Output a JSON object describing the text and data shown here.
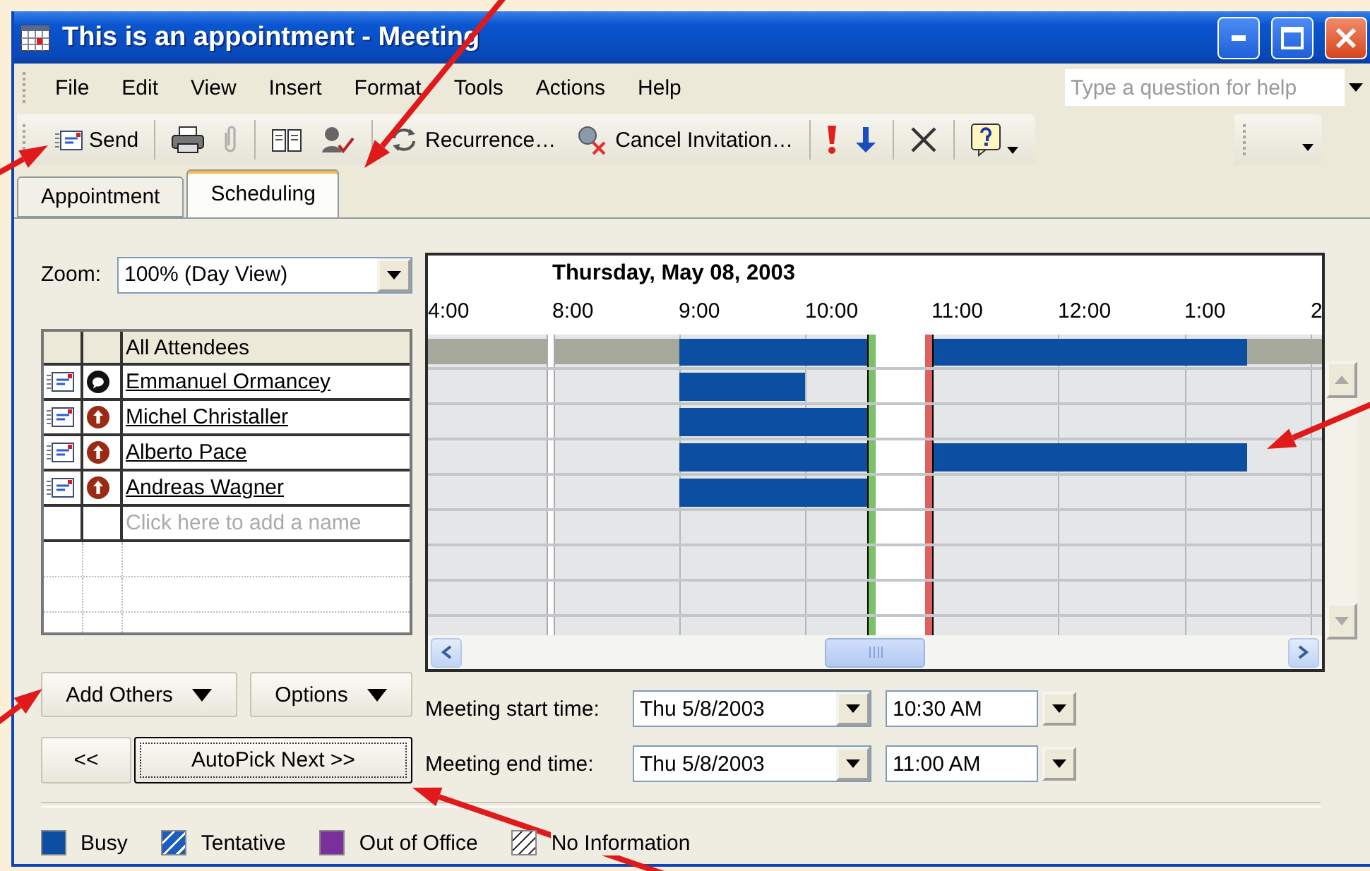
{
  "window": {
    "title": "This is an appointment - Meeting"
  },
  "menu": [
    "File",
    "Edit",
    "View",
    "Insert",
    "Format",
    "Tools",
    "Actions",
    "Help"
  ],
  "help_box": {
    "placeholder": "Type a question for help"
  },
  "toolbar": {
    "send": "Send",
    "attach_disabled": true,
    "recurrence": "Recurrence…",
    "cancel_invitation": "Cancel Invitation…"
  },
  "tabs": [
    {
      "label": "Appointment",
      "selected": false
    },
    {
      "label": "Scheduling",
      "selected": true
    }
  ],
  "zoom": {
    "label": "Zoom:",
    "value": "100% (Day View)"
  },
  "attendees": {
    "header": "All Attendees",
    "all_busy_slots": [
      false,
      false,
      true,
      true,
      true,
      false,
      true,
      true,
      true,
      true,
      true,
      false
    ],
    "placeholder": "Click here to add a name",
    "rows": [
      {
        "name": "Emmanuel Ormancey",
        "kind": "organizer",
        "busy_slots": [
          false,
          false,
          true,
          true,
          false,
          false,
          false,
          false,
          false,
          false,
          false,
          false
        ]
      },
      {
        "name": "Michel Christaller",
        "kind": "required",
        "busy_slots": [
          false,
          false,
          true,
          true,
          true,
          false,
          false,
          false,
          false,
          false,
          false,
          false
        ]
      },
      {
        "name": "Alberto Pace",
        "kind": "required",
        "busy_slots": [
          false,
          false,
          true,
          true,
          true,
          false,
          true,
          true,
          true,
          true,
          true,
          false
        ]
      },
      {
        "name": "Andreas Wagner",
        "kind": "required",
        "busy_slots": [
          false,
          false,
          true,
          true,
          true,
          false,
          false,
          false,
          false,
          false,
          false,
          false
        ]
      }
    ]
  },
  "schedule": {
    "date": "Thursday, May 08, 2003",
    "hours": [
      "4:00",
      "8:00",
      "9:00",
      "10:00",
      "11:00",
      "12:00",
      "1:00",
      "2"
    ]
  },
  "buttons": {
    "add_others": "Add Others",
    "options": "Options",
    "previous": "<<",
    "autopick_next": "AutoPick Next >>"
  },
  "meeting_start": {
    "label": "Meeting start time:",
    "date": "Thu 5/8/2003",
    "time": "10:30 AM"
  },
  "meeting_end": {
    "label": "Meeting end time:",
    "date": "Thu 5/8/2003",
    "time": "11:00 AM"
  },
  "legend": [
    {
      "label": "Busy",
      "kind": "busy",
      "color": "#0b4ea2"
    },
    {
      "label": "Tentative",
      "kind": "tentative",
      "color": "#1a5cc0"
    },
    {
      "label": "Out of Office",
      "kind": "out_of_office",
      "color": "#7a2f9a"
    },
    {
      "label": "No Information",
      "kind": "no_information",
      "color": "#ffffff"
    }
  ]
}
